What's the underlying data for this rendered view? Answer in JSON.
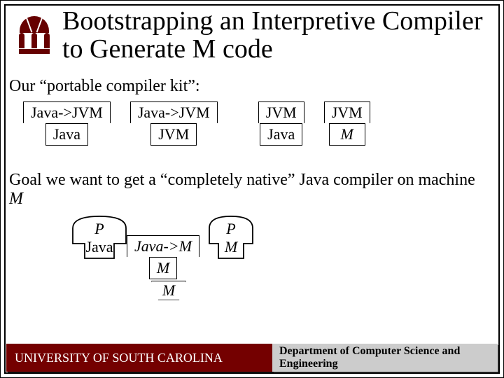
{
  "title": "Bootstrapping an Interpretive Compiler to Generate M code",
  "sub1": "Our “portable compiler kit”:",
  "kit": {
    "t1_top": "Java->JVM",
    "t1_bot": "Java",
    "t2_top": "Java->JVM",
    "t2_bot": "JVM",
    "t3_top": "JVM",
    "t3_bot": "Java",
    "t4_top": "JVM",
    "t4_bot": "M"
  },
  "goal_line_pre": "Goal we want to get a “completely native” Java compiler on machine ",
  "goal_line_em": "M",
  "goal": {
    "prog1_top": "P",
    "prog1_bot": "Java",
    "comp_top": "Java->M",
    "comp_bot": "M",
    "prog2_top": "P",
    "prog2_bot": "M",
    "run_bot": "M"
  },
  "footer_left": "UNIVERSITY OF SOUTH CAROLINA",
  "footer_right": "Department of Computer Science and Engineering"
}
